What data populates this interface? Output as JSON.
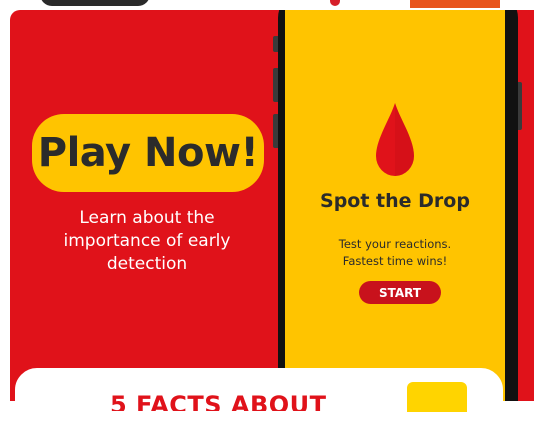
{
  "colors": {
    "card_red": "#e0121a",
    "pill_yellow": "#ffc400",
    "phone_black": "#111111",
    "drop_red": "#e0121a",
    "start_red": "#c8121c",
    "text_dark": "#2b2b2b",
    "text_light": "#ffffff"
  },
  "promo": {
    "cta_label": "Play Now!",
    "subtitle": "Learn about the importance of early detection"
  },
  "game": {
    "icon": "blood-drop-icon",
    "title": "Spot the Drop",
    "description_lines": [
      "Test your reactions.",
      "Fastest time wins!"
    ],
    "start_label": "START"
  },
  "bottom": {
    "headline_cropped": "5 FACTS ABOUT"
  }
}
